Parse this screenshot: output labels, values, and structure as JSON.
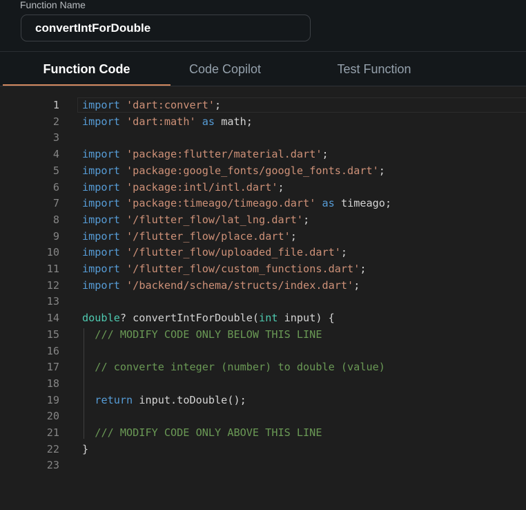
{
  "function_name": {
    "label": "Function Name",
    "value": "convertIntForDouble"
  },
  "tabs": [
    {
      "label": "Function Code",
      "active": true
    },
    {
      "label": "Code Copilot",
      "active": false
    },
    {
      "label": "Test Function",
      "active": false
    }
  ],
  "editor": {
    "active_line": 1,
    "lines": [
      {
        "num": "1",
        "tokens": [
          {
            "t": "import",
            "c": "kw"
          },
          {
            "t": " ",
            "c": "txt"
          },
          {
            "t": "'dart:convert'",
            "c": "str"
          },
          {
            "t": ";",
            "c": "txt"
          }
        ]
      },
      {
        "num": "2",
        "tokens": [
          {
            "t": "import",
            "c": "kw"
          },
          {
            "t": " ",
            "c": "txt"
          },
          {
            "t": "'dart:math'",
            "c": "str"
          },
          {
            "t": " ",
            "c": "txt"
          },
          {
            "t": "as",
            "c": "kw"
          },
          {
            "t": " math;",
            "c": "txt"
          }
        ]
      },
      {
        "num": "3",
        "tokens": []
      },
      {
        "num": "4",
        "tokens": [
          {
            "t": "import",
            "c": "kw"
          },
          {
            "t": " ",
            "c": "txt"
          },
          {
            "t": "'package:flutter/material.dart'",
            "c": "str"
          },
          {
            "t": ";",
            "c": "txt"
          }
        ]
      },
      {
        "num": "5",
        "tokens": [
          {
            "t": "import",
            "c": "kw"
          },
          {
            "t": " ",
            "c": "txt"
          },
          {
            "t": "'package:google_fonts/google_fonts.dart'",
            "c": "str"
          },
          {
            "t": ";",
            "c": "txt"
          }
        ]
      },
      {
        "num": "6",
        "tokens": [
          {
            "t": "import",
            "c": "kw"
          },
          {
            "t": " ",
            "c": "txt"
          },
          {
            "t": "'package:intl/intl.dart'",
            "c": "str"
          },
          {
            "t": ";",
            "c": "txt"
          }
        ]
      },
      {
        "num": "7",
        "tokens": [
          {
            "t": "import",
            "c": "kw"
          },
          {
            "t": " ",
            "c": "txt"
          },
          {
            "t": "'package:timeago/timeago.dart'",
            "c": "str"
          },
          {
            "t": " ",
            "c": "txt"
          },
          {
            "t": "as",
            "c": "kw"
          },
          {
            "t": " timeago;",
            "c": "txt"
          }
        ]
      },
      {
        "num": "8",
        "tokens": [
          {
            "t": "import",
            "c": "kw"
          },
          {
            "t": " ",
            "c": "txt"
          },
          {
            "t": "'/flutter_flow/lat_lng.dart'",
            "c": "str"
          },
          {
            "t": ";",
            "c": "txt"
          }
        ]
      },
      {
        "num": "9",
        "tokens": [
          {
            "t": "import",
            "c": "kw"
          },
          {
            "t": " ",
            "c": "txt"
          },
          {
            "t": "'/flutter_flow/place.dart'",
            "c": "str"
          },
          {
            "t": ";",
            "c": "txt"
          }
        ]
      },
      {
        "num": "10",
        "tokens": [
          {
            "t": "import",
            "c": "kw"
          },
          {
            "t": " ",
            "c": "txt"
          },
          {
            "t": "'/flutter_flow/uploaded_file.dart'",
            "c": "str"
          },
          {
            "t": ";",
            "c": "txt"
          }
        ]
      },
      {
        "num": "11",
        "tokens": [
          {
            "t": "import",
            "c": "kw"
          },
          {
            "t": " ",
            "c": "txt"
          },
          {
            "t": "'/flutter_flow/custom_functions.dart'",
            "c": "str"
          },
          {
            "t": ";",
            "c": "txt"
          }
        ]
      },
      {
        "num": "12",
        "tokens": [
          {
            "t": "import",
            "c": "kw"
          },
          {
            "t": " ",
            "c": "txt"
          },
          {
            "t": "'/backend/schema/structs/index.dart'",
            "c": "str"
          },
          {
            "t": ";",
            "c": "txt"
          }
        ]
      },
      {
        "num": "13",
        "tokens": []
      },
      {
        "num": "14",
        "tokens": [
          {
            "t": "double",
            "c": "typ"
          },
          {
            "t": "? convertIntForDouble(",
            "c": "txt"
          },
          {
            "t": "int",
            "c": "typ"
          },
          {
            "t": " input) {",
            "c": "txt"
          }
        ]
      },
      {
        "num": "15",
        "tokens": [
          {
            "t": "  ",
            "c": "txt"
          },
          {
            "t": "/// MODIFY CODE ONLY BELOW THIS LINE",
            "c": "cm"
          }
        ]
      },
      {
        "num": "16",
        "tokens": []
      },
      {
        "num": "17",
        "tokens": [
          {
            "t": "  ",
            "c": "txt"
          },
          {
            "t": "// converte integer (number) to double (value)",
            "c": "cm"
          }
        ]
      },
      {
        "num": "18",
        "tokens": []
      },
      {
        "num": "19",
        "tokens": [
          {
            "t": "  ",
            "c": "txt"
          },
          {
            "t": "return",
            "c": "kw"
          },
          {
            "t": " input.toDouble();",
            "c": "txt"
          }
        ]
      },
      {
        "num": "20",
        "tokens": []
      },
      {
        "num": "21",
        "tokens": [
          {
            "t": "  ",
            "c": "txt"
          },
          {
            "t": "/// MODIFY CODE ONLY ABOVE THIS LINE",
            "c": "cm"
          }
        ]
      },
      {
        "num": "22",
        "tokens": [
          {
            "t": "}",
            "c": "txt"
          }
        ]
      },
      {
        "num": "23",
        "tokens": []
      }
    ]
  },
  "colors": {
    "accent_underline": "#d2895f",
    "keyword": "#569cd6",
    "string": "#ce9178",
    "type": "#4ec9b0",
    "comment": "#6a9955"
  }
}
